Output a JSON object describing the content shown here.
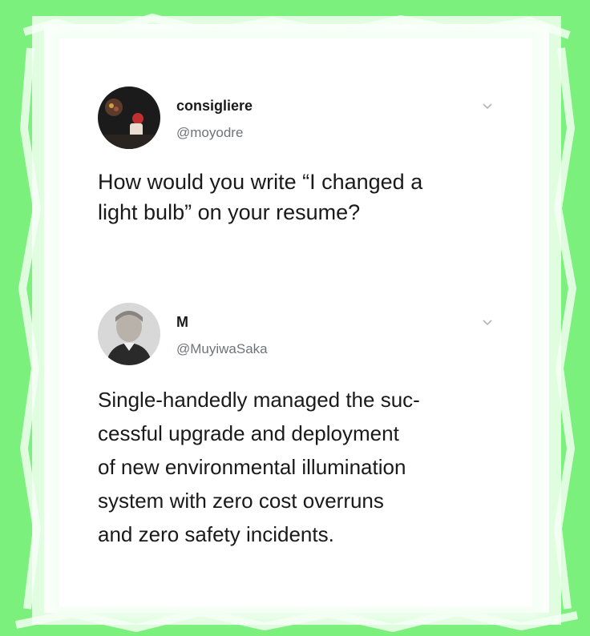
{
  "tweets": [
    {
      "display_name": "consigliere",
      "handle": "@moyodre",
      "text": "How would you write “I changed a\nlight bulb” on your resume?",
      "avatar_icon": "profile-avatar-icon",
      "menu_icon": "chevron-down-icon"
    },
    {
      "display_name": "M",
      "handle": "@MuyiwaSaka",
      "text": "Single-handedly managed the suc-\ncessful upgrade and deployment\nof new environmental illumination\nsystem with zero cost overruns\nand zero safety incidents.",
      "avatar_icon": "profile-avatar-icon",
      "menu_icon": "chevron-down-icon"
    }
  ],
  "colors": {
    "frame_green": "#7cf07c",
    "card_bg": "#ffffff",
    "text_primary": "#1a1a1a",
    "text_secondary": "#6e7479"
  }
}
